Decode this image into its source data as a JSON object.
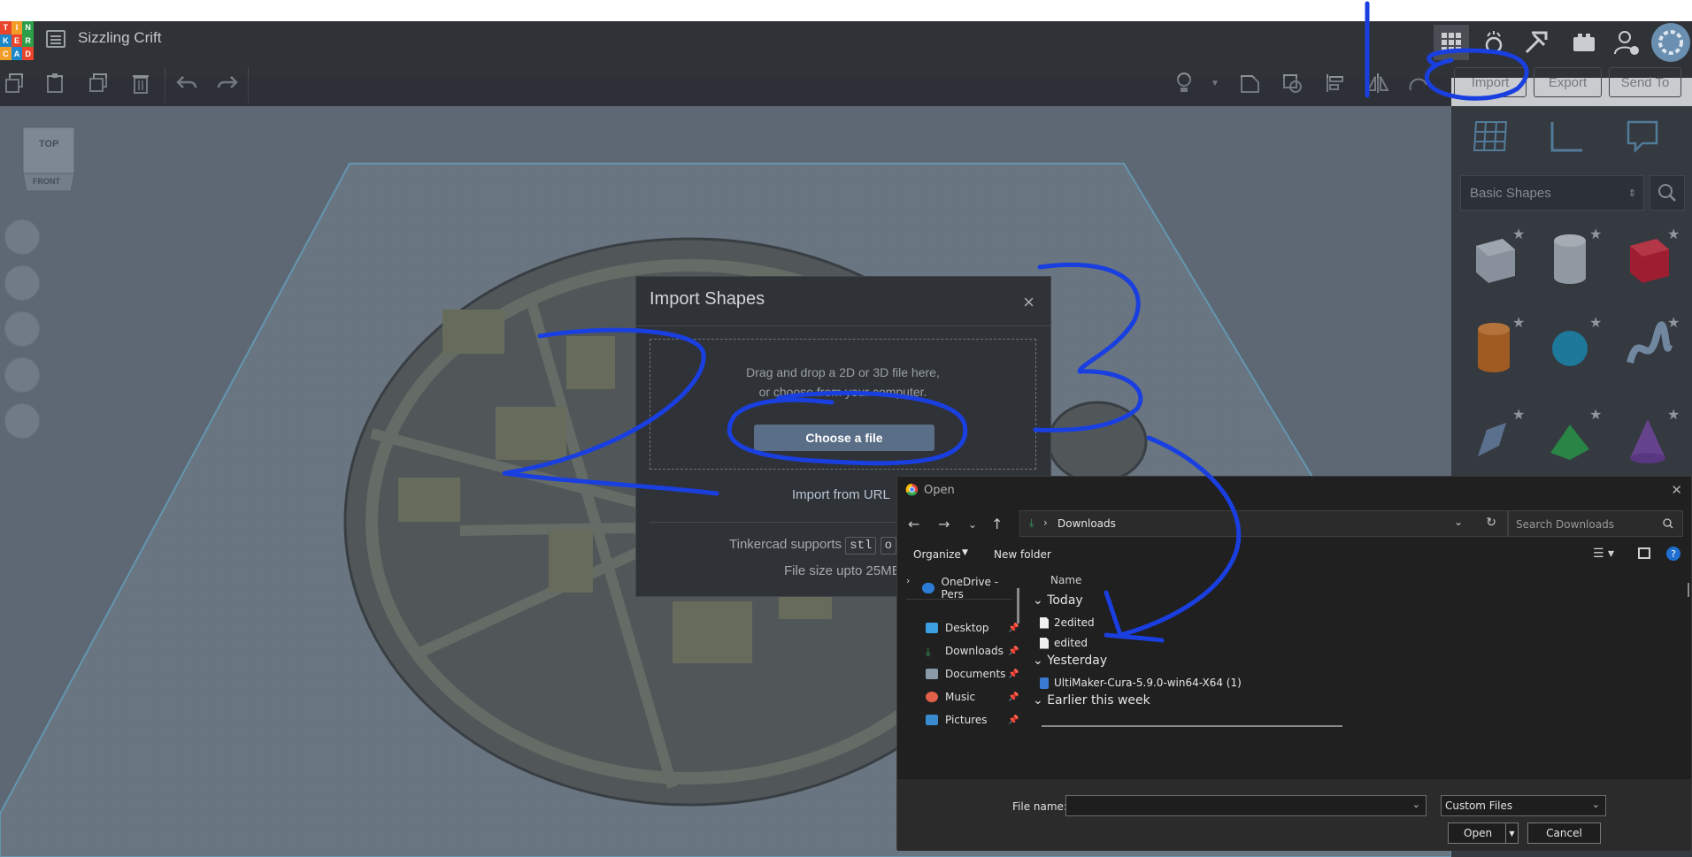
{
  "app": {
    "logo_letters": [
      "T",
      "I",
      "N",
      "K",
      "E",
      "R",
      "C",
      "A",
      "D"
    ],
    "document_title": "Sizzling Crift"
  },
  "toolbar": {
    "import_label": "Import",
    "export_label": "Export",
    "send_to_label": "Send To"
  },
  "viewcube": {
    "top_label": "TOP",
    "front_label": "FRONT"
  },
  "shapes_panel": {
    "category": "Basic Shapes"
  },
  "import_modal": {
    "title": "Import Shapes",
    "close": "×",
    "drop_line1": "Drag and drop a 2D or 3D file here,",
    "drop_line2": "or choose from your computer.",
    "choose_button": "Choose a file",
    "import_url": "Import from URL",
    "supports_text": "Tinkercad supports",
    "format_1": "stl",
    "format_2": "o",
    "file_size": "File size upto 25MB"
  },
  "open_dialog": {
    "title": "Open",
    "path": "Downloads",
    "search_placeholder": "Search Downloads",
    "organize": "Organize",
    "new_folder": "New folder",
    "nav": {
      "onedrive": "OneDrive - Pers",
      "desktop": "Desktop",
      "downloads": "Downloads",
      "documents": "Documents",
      "music": "Music",
      "pictures": "Pictures"
    },
    "column_name": "Name",
    "groups": {
      "today": "Today",
      "yesterday": "Yesterday",
      "earlier": "Earlier this week"
    },
    "files": {
      "f1": "2edited",
      "f2": "edited",
      "f3": "UltiMaker-Cura-5.9.0-win64-X64 (1)"
    },
    "file_name_label": "File name:",
    "file_type": "Custom Files",
    "open_button": "Open",
    "cancel_button": "Cancel"
  },
  "colors": {
    "annotation": "#1a3fe0",
    "choose_button": "#5a6e87"
  }
}
